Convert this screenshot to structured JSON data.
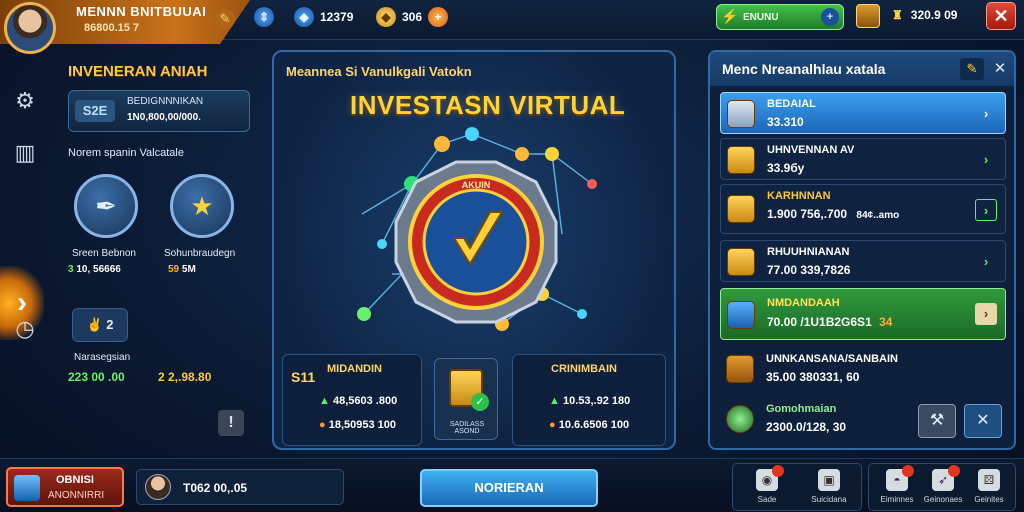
{
  "profile": {
    "name": "MENNN BNITBUUAI",
    "sub": "86800.15 7"
  },
  "currencies": [
    {
      "icon": "gem-icon",
      "value": "12379"
    },
    {
      "icon": "gold-diamond-icon",
      "value": "306"
    }
  ],
  "boost": {
    "label": "ENUNU"
  },
  "trophy": {
    "value": "320.9 09"
  },
  "left_panel": {
    "title": "INVENERAN ANIAH",
    "balance": {
      "tag": "S2E",
      "label": "BEDIGNNNIKAN",
      "value": "1N0,800,00/000."
    },
    "subtitle": "Norem spanin Valcatale",
    "skills": [
      {
        "icon": "pen-icon",
        "name": "Sreen Bebnon",
        "value_prefix": "3",
        "value": "10, 56666"
      },
      {
        "icon": "star-icon",
        "name": "Sohunbraudegn",
        "value_prefix": "59",
        "value": "5M"
      }
    ],
    "mini": {
      "label": "2",
      "name": "Narasegsian",
      "value1": "223 00 .00",
      "value2": "2 2,.98.80"
    }
  },
  "center_panel": {
    "subtitle": "Meannea Si Vanulkgali Vatokn",
    "title": "INVESTASN VIRTUAL",
    "emblem_ring_text": "AKUIN",
    "card_left": {
      "number": "S11",
      "head": "MIDANDIN",
      "rows": [
        {
          "value": "48,5603 .800"
        },
        {
          "value": "18,50953 100"
        }
      ]
    },
    "certificate": {
      "label": "SADILASS ASOND"
    },
    "card_right": {
      "head": "CRINIMBAIN",
      "rows": [
        {
          "value": "10.53,.92 180"
        },
        {
          "value": "10.6.6506 100"
        }
      ]
    }
  },
  "right_panel": {
    "title": "Menc Nreanalhlau xatala",
    "rows": [
      {
        "icon": "scroll-icon",
        "name": "BEDAIAL",
        "value": "33.310",
        "style": "selected"
      },
      {
        "icon": "ledger-icon",
        "name": "UHNVENNAN AV",
        "value": "33.9бу",
        "style": "normal"
      },
      {
        "icon": "chest-icon",
        "name": "KARHNNAN",
        "value": "1.900 756,.700",
        "extra": "84¢..amo",
        "style": "normal"
      },
      {
        "icon": "coin-icon",
        "name": "RHUUHNIANAN",
        "value": "77.00 339,7826",
        "style": "normal"
      },
      {
        "icon": "cube-icon",
        "name": "NMDANDAAH",
        "value": "70.00 /1U1B2G6S1",
        "extra": "34",
        "style": "green"
      },
      {
        "icon": "crate-icon",
        "name": "UNNKANSANA/SANBAIN",
        "value": "35.00 380331, 60",
        "style": "plain"
      },
      {
        "icon": "cycle-icon",
        "name": "Gomohmaian",
        "value": "2300.0/128, 30",
        "style": "plain"
      }
    ]
  },
  "bottom": {
    "left_button": {
      "title": "OBNISI",
      "sub": "ANONNIRRI"
    },
    "user_value": "T062 00,.05",
    "main_button": "NORIERAN",
    "nav": [
      {
        "icon": "disc-icon",
        "label": "Sade"
      },
      {
        "icon": "box-icon",
        "label": "Suicidana"
      },
      {
        "icon": "helmet-icon",
        "label": "Eiminnes"
      },
      {
        "icon": "rocket-icon",
        "label": "Geinonaes"
      },
      {
        "icon": "dice-icon",
        "label": "Geinites"
      }
    ]
  }
}
